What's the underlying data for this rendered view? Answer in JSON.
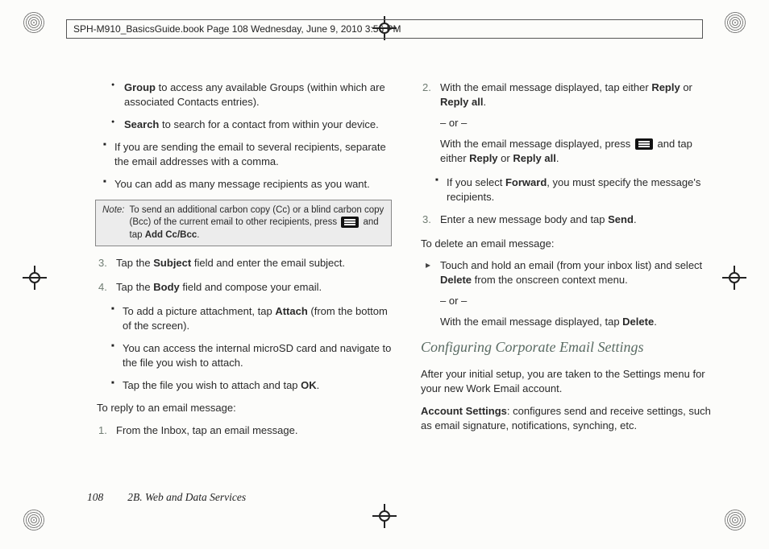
{
  "header": {
    "text": "SPH-M910_BasicsGuide.book  Page 108  Wednesday, June 9, 2010  3:56 PM"
  },
  "left": {
    "bullets": [
      {
        "bold": "Group",
        "rest": " to access any available Groups (within which are associated Contacts entries)."
      },
      {
        "bold": "Search",
        "rest": " to search for a contact from within your device."
      }
    ],
    "squares1": [
      "If you are sending the email to several recipients, separate the email addresses with a comma.",
      "You can add as many message recipients as you want."
    ],
    "note": {
      "label": "Note:",
      "body_a": "To send an additional carbon copy (Cc) or a blind carbon copy (Bcc) of the current email to other recipients, press ",
      "body_b": " and tap ",
      "bold": "Add Cc/Bcc",
      "body_c": "."
    },
    "steps": [
      {
        "n": "3.",
        "pre": "Tap the ",
        "bold": "Subject",
        "post": " field and enter the email subject."
      },
      {
        "n": "4.",
        "pre": "Tap the ",
        "bold": "Body",
        "post": " field and compose your email."
      }
    ],
    "squares2": [
      {
        "pre": "To add a picture attachment, tap ",
        "bold": "Attach",
        "post": " (from the bottom of the screen)."
      },
      {
        "pre": "You can access the internal microSD card and navigate to the file you wish to attach.",
        "bold": "",
        "post": ""
      },
      {
        "pre": "Tap the file you wish to attach and tap ",
        "bold": "OK",
        "post": "."
      }
    ],
    "lead1": "To reply to an email message:",
    "reply_steps": [
      {
        "n": "1.",
        "text": "From the Inbox, tap an email message."
      }
    ]
  },
  "right": {
    "step2": {
      "n": "2.",
      "line1_a": "With the email message displayed, tap either ",
      "line1_b1": "Reply",
      "line1_mid": " or ",
      "line1_b2": "Reply all",
      "line1_end": ".",
      "or": "– or –",
      "line2_a": "With the email message displayed, press ",
      "line2_b": " and tap either ",
      "line2_b1": "Reply",
      "line2_mid": " or ",
      "line2_b2": "Reply all",
      "line2_end": "."
    },
    "sq_forward": {
      "pre": "If you select ",
      "bold": "Forward",
      "post": ", you must specify the message's recipients."
    },
    "step3": {
      "n": "3.",
      "pre": "Enter a new message body and tap ",
      "bold": "Send",
      "post": "."
    },
    "lead_delete": "To delete an email message:",
    "arrow": {
      "a": "Touch and hold an email (from your inbox list) and select ",
      "b1": "Delete",
      "c": " from the onscreen context menu.",
      "or": "– or –",
      "d": "With the email message displayed, tap ",
      "b2": "Delete",
      "e": "."
    },
    "h2": "Configuring Corporate Email Settings",
    "p1": "After your initial setup, you are taken to the Settings menu for your new Work Email account.",
    "p2_bold": "Account Settings",
    "p2_rest": ": configures send and receive settings, such as email signature, notifications, synching, etc."
  },
  "footer": {
    "page": "108",
    "section": "2B. Web and Data Services"
  }
}
